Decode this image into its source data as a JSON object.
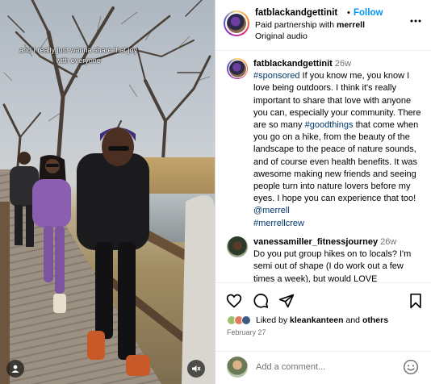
{
  "media": {
    "caption_overlay": "and I really just wanna share that joy with everyone",
    "icons": {
      "bottom_left": "profile-tag-icon",
      "bottom_right": "mute-icon"
    }
  },
  "post_header": {
    "username": "fatblackandgettinit",
    "dot": "•",
    "follow_label": "Follow",
    "partnership_prefix": "Paid partnership with",
    "partner": "merrell",
    "audio": "Original audio"
  },
  "caption": {
    "username": "fatblackandgettinit",
    "time": "26w",
    "hashtag_sponsored": "#sponsored",
    "text_1": " If you know me, you know I love being outdoors. I think it's really important to share that love with anyone you can, especially your community. There are so many ",
    "hashtag_goodthings": "#goodthings",
    "text_2": " that come when you go on a hike, from the beauty of the landscape to the peace of nature sounds, and of course even health benefits. It was awesome making new friends and seeing people turn into nature lovers before my eyes. I hope you can experience that too! ",
    "mention_merrell": "@merrell",
    "hashtag_merrellcrew": "#merrellcrew"
  },
  "comment_1": {
    "username": "vanessamiller_fitnessjourney",
    "time": "26w",
    "text": "Do you put group hikes on to locals? I'm semi out of shape (I do work out a few times a week), but would LOVE"
  },
  "actions": {
    "icons": [
      "heart-icon",
      "comment-icon",
      "share-icon",
      "bookmark-icon"
    ],
    "liked_prefix": "Liked by",
    "liked_user": "kleankanteen",
    "liked_and": "and",
    "liked_others": "others",
    "date": "February 27"
  },
  "comment_box": {
    "placeholder": "Add a comment..."
  },
  "colors": {
    "link_blue": "#0095f6",
    "hashtag": "#00376b",
    "muted": "#737373"
  }
}
